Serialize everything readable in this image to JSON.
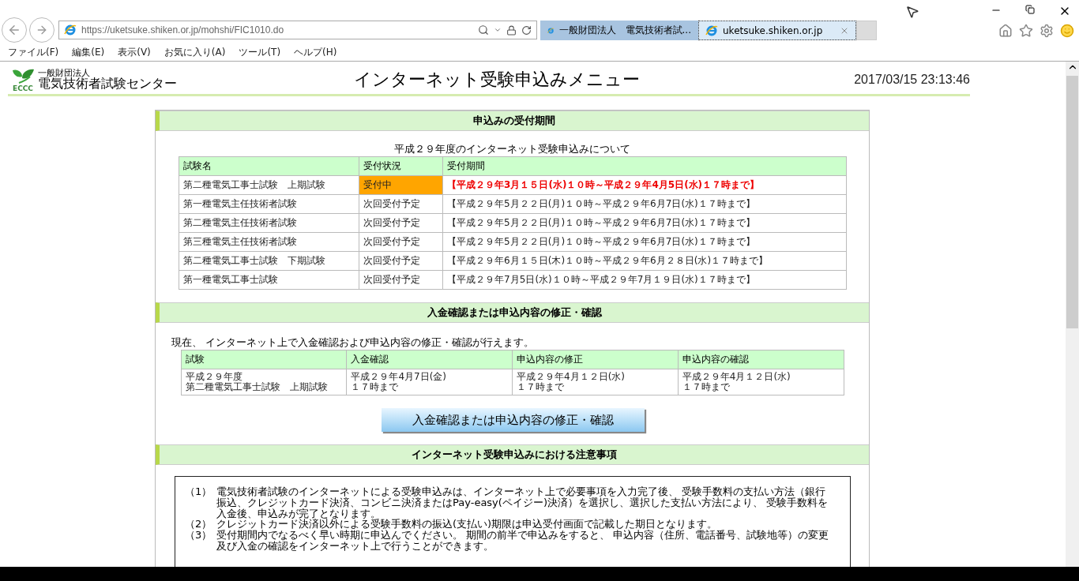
{
  "browser": {
    "address": "https://uketsuke.shiken.or.jp/mohshi/FIC1010.do",
    "tabs": [
      {
        "title": "一般財団法人　電気技術者試...",
        "selected": false
      },
      {
        "title": "uketsuke.shiken.or.jp",
        "selected": true
      }
    ],
    "menu": [
      "ファイル(F)",
      "編集(E)",
      "表示(V)",
      "お気に入り(A)",
      "ツール(T)",
      "ヘルプ(H)"
    ]
  },
  "header": {
    "logo_caption": "ECCC",
    "org_type": "一般財団法人",
    "org_name": "電気技術者試験センター",
    "title": "インターネット受験申込みメニュー",
    "datetime": "2017/03/15 23:13:46"
  },
  "period_section": {
    "heading": "申込みの受付期間",
    "caption": "平成２９年度のインターネット受験申込みについて",
    "columns": [
      "試験名",
      "受付状況",
      "受付期間"
    ],
    "rows": [
      {
        "exam": "第二種電気工事士試験　上期試験",
        "status": "受付中",
        "period": "【平成２９年3月１５日(水)１０時～平成２９年4月5日(水)１７時まで】",
        "accepting": true
      },
      {
        "exam": "第一種電気主任技術者試験",
        "status": "次回受付予定",
        "period": "【平成２９年5月２２日(月)１０時～平成２９年6月7日(水)１７時まで】",
        "accepting": false
      },
      {
        "exam": "第二種電気主任技術者試験",
        "status": "次回受付予定",
        "period": "【平成２９年5月２２日(月)１０時～平成２９年6月7日(水)１７時まで】",
        "accepting": false
      },
      {
        "exam": "第三種電気主任技術者試験",
        "status": "次回受付予定",
        "period": "【平成２９年5月２２日(月)１０時～平成２９年6月7日(水)１７時まで】",
        "accepting": false
      },
      {
        "exam": "第二種電気工事士試験　下期試験",
        "status": "次回受付予定",
        "period": "【平成２９年6月１５日(木)１０時～平成２９年6月２８日(水)１７時まで】",
        "accepting": false
      },
      {
        "exam": "第一種電気工事士試験",
        "status": "次回受付予定",
        "period": "【平成２９年7月5日(水)１０時～平成２９年7月１９日(水)１７時まで】",
        "accepting": false
      }
    ]
  },
  "payment_section": {
    "heading": "入金確認または申込内容の修正・確認",
    "notice": "現在、 インターネット上で入金確認および申込内容の修正・確認が行えます。",
    "columns": [
      "試験",
      "入金確認",
      "申込内容の修正",
      "申込内容の確認"
    ],
    "rows": [
      {
        "cells": [
          [
            "平成２９年度",
            "第二種電気工事士試験　上期試験"
          ],
          [
            "平成２９年4月7日(金)",
            "１７時まで"
          ],
          [
            "平成２９年4月１２日(水)",
            "１７時まで"
          ],
          [
            "平成２９年4月１２日(水)",
            "１７時まで"
          ]
        ]
      }
    ],
    "button": "入金確認または申込内容の修正・確認"
  },
  "notes_section": {
    "heading": "インターネット受験申込みにおける注意事項",
    "notes": [
      {
        "number": "（1）",
        "text": "電気技術者試験のインターネットによる受験申込みは、インターネット上で必要事項を入力完了後、 受験手数料の支払い方法（銀行振込、クレジットカード決済、コンビニ決済またはPay-easy(ペイジー)決済）を選択し、選択した支払い方法により、 受験手数料を入金後、申込みが完了となります。"
      },
      {
        "number": "（2）",
        "text": "クレジットカード決済以外による受験手数料の振込(支払い)期限は申込受付画面で記載した期日となります。"
      },
      {
        "number": "（3）",
        "text": "受付期間内でなるべく早い時期に申込んでください。 期間の前半で申込みをすると、 申込内容（住所、電話番号、試験地等）の変更及び入金の確認をインターネット上で行うことができます。"
      }
    ]
  }
}
